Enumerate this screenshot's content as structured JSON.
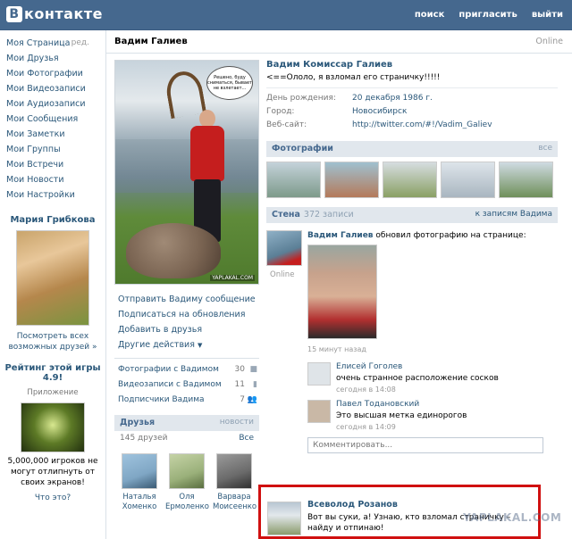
{
  "header": {
    "logo_letter": "В",
    "logo_text": "контакте",
    "nav": [
      "поиск",
      "пригласить",
      "выйти"
    ]
  },
  "sidebar": {
    "items": [
      {
        "label": "Моя Страница",
        "extra": "ред."
      },
      {
        "label": "Мои Друзья"
      },
      {
        "label": "Мои Фотографии"
      },
      {
        "label": "Мои Видеозаписи"
      },
      {
        "label": "Мои Аудиозаписи"
      },
      {
        "label": "Мои Сообщения"
      },
      {
        "label": "Мои Заметки"
      },
      {
        "label": "Мои Группы"
      },
      {
        "label": "Мои Встречи"
      },
      {
        "label": "Мои Новости"
      },
      {
        "label": "Мои Настройки"
      }
    ],
    "suggest": {
      "name": "Мария Грибкова",
      "link": "Посмотреть всех возможных друзей »"
    },
    "game": {
      "title": "Рейтинг этой игры 4.9!",
      "subtitle": "Приложение",
      "text": "5,000,000 игроков не могут отлипнуть от своих экранов!",
      "what": "Что это?"
    }
  },
  "profile": {
    "name_header": "Вадим Галиев",
    "online": "Online",
    "full_name": "Вадим Комиссар Галиев",
    "status": "<==Ололо, я взломал его страничку!!!!!",
    "avatar_bubble": "Решено, буду сниматься, бывает не взлетает...",
    "avatar_watermark": "YAPLAKAL.COM",
    "info": [
      {
        "label": "День рождения:",
        "value": "20 декабря 1986 г."
      },
      {
        "label": "Город:",
        "value": "Новосибирск"
      },
      {
        "label": "Веб-сайт:",
        "value": "http://twitter.com/#!/Vadim_Galiev"
      }
    ],
    "actions": [
      "Отправить Вадиму сообщение",
      "Подписаться на обновления",
      "Добавить в друзья",
      "Другие действия"
    ],
    "stats": [
      {
        "label": "Фотографии с Вадимом",
        "count": "30"
      },
      {
        "label": "Видеозаписи с Вадимом",
        "count": "11"
      },
      {
        "label": "Подписчики Вадима",
        "count": "7"
      }
    ]
  },
  "friends": {
    "title": "Друзья",
    "new_label": "новости",
    "count": "145 друзей",
    "all_label": "Все",
    "items": [
      {
        "first": "Наталья",
        "last": "Хоменко",
        "color": "#7fa6c4"
      },
      {
        "first": "Оля",
        "last": "Ермоленко",
        "color": "#9ab07a"
      },
      {
        "first": "Варвара",
        "last": "Моисеенко",
        "color": "#6a6a6a"
      }
    ]
  },
  "photos": {
    "title": "Фотографии",
    "all_label": "все",
    "thumb_colors": [
      "#7d9a8a",
      "#b47a5a",
      "#8aa064",
      "#a9b6c0",
      "#6f8f5a"
    ]
  },
  "wall": {
    "title": "Стена",
    "count": "372 записи",
    "link": "к записям Вадима",
    "post": {
      "author": "Вадим Галиев",
      "action": "обновил фотографию на странице:",
      "online": "Online",
      "time": "15 минут назад"
    },
    "comments": [
      {
        "name": "Елисей Гоголев",
        "text": "очень странное расположение сосков",
        "time": "сегодня в 14:08",
        "color": "#dfe4e8"
      },
      {
        "name": "Павел Тодановский",
        "text": "Это высшая метка единорогов",
        "time": "сегодня в 14:09",
        "color": "#c9b8a6"
      }
    ],
    "comment_placeholder": "Комментировать...",
    "highlighted": {
      "name": "Всеволод Розанов",
      "text": "Вот вы суки, а! Узнаю, кто взломал страничку – найду и отпинаю!"
    }
  },
  "watermark": "YAPLAKAL.COM"
}
